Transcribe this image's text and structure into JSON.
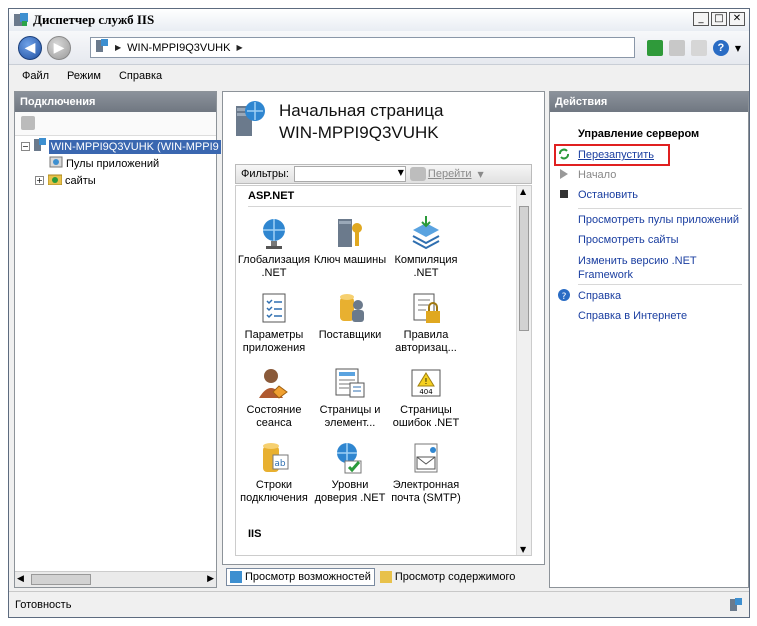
{
  "window": {
    "title": "Диспетчер служб IIS"
  },
  "address": {
    "crumb": "WIN-MPPI9Q3VUHK"
  },
  "menu": [
    "Файл",
    "Режим",
    "Справка"
  ],
  "connections": {
    "title": "Подключения",
    "server": "WIN-MPPI9Q3VUHK (WIN-MPPI9",
    "app_pools": "Пулы приложений",
    "sites": "сайты"
  },
  "center": {
    "title_line1": "Начальная страница",
    "title_line2": "WIN-MPPI9Q3VUHK",
    "filter_label": "Фильтры:",
    "go_label": "Перейти",
    "group_aspnet": "ASP.NET",
    "group_iis": "IIS",
    "features": [
      {
        "l1": "Глобализация",
        "l2": ".NET"
      },
      {
        "l1": "Ключ машины",
        "l2": ""
      },
      {
        "l1": "Компиляция",
        "l2": ".NET"
      },
      {
        "l1": "Параметры",
        "l2": "приложения"
      },
      {
        "l1": "Поставщики",
        "l2": ""
      },
      {
        "l1": "Правила",
        "l2": "авторизац..."
      },
      {
        "l1": "Состояние",
        "l2": "сеанса"
      },
      {
        "l1": "Страницы и",
        "l2": "элемент..."
      },
      {
        "l1": "Страницы",
        "l2": "ошибок .NET"
      },
      {
        "l1": "Строки",
        "l2": "подключения"
      },
      {
        "l1": "Уровни",
        "l2": "доверия .NET"
      },
      {
        "l1": "Электронная",
        "l2": "почта (SMTP)"
      }
    ],
    "tab_features": "Просмотр возможностей",
    "tab_content": "Просмотр содержимого"
  },
  "actions": {
    "title": "Действия",
    "manage_server": "Управление сервером",
    "restart": "Перезапустить",
    "start": "Начало",
    "stop": "Остановить",
    "view_pools": "Просмотреть пулы приложений",
    "view_sites": "Просмотреть сайты",
    "change_net_1": "Изменить версию .NET",
    "change_net_2": "Framework",
    "help": "Справка",
    "online_help": "Справка в Интернете"
  },
  "status": {
    "text": "Готовность"
  }
}
